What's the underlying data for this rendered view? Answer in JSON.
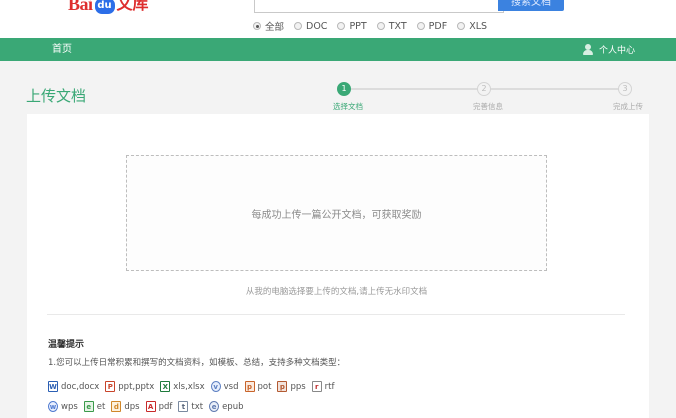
{
  "header": {
    "logo": {
      "bai": "Bai",
      "paw": "du",
      "wenku": "文库"
    },
    "search": {
      "button_label": "搜索文档",
      "placeholder": ""
    },
    "filters": [
      {
        "label": "全部",
        "checked": true
      },
      {
        "label": "DOC",
        "checked": false
      },
      {
        "label": "PPT",
        "checked": false
      },
      {
        "label": "TXT",
        "checked": false
      },
      {
        "label": "PDF",
        "checked": false
      },
      {
        "label": "XLS",
        "checked": false
      }
    ]
  },
  "nav": {
    "home": "首页",
    "user_center": "个人中心",
    "user_icon": "user-icon"
  },
  "page": {
    "title": "上传文档",
    "steps": [
      {
        "number": "1",
        "label": "选择文档",
        "active": true
      },
      {
        "number": "2",
        "label": "完善信息",
        "active": false
      },
      {
        "number": "3",
        "label": "完成上传",
        "active": false
      }
    ]
  },
  "upload": {
    "dropzone_text": "每成功上传一篇公开文档，可获取奖励",
    "hint": "从我的电脑选择要上传的文档,请上传无水印文档"
  },
  "tips": {
    "title": "温馨提示",
    "line1": "1.您可以上传日常积累和撰写的文档资料，如模板、总结，支持多种文档类型：",
    "types_row1": [
      {
        "icon": "W",
        "label": "doc,docx"
      },
      {
        "icon": "P",
        "label": "ppt,pptx"
      },
      {
        "icon": "X",
        "label": "xls,xlsx"
      },
      {
        "icon": "v",
        "label": "vsd"
      },
      {
        "icon": "p",
        "label": "pot"
      },
      {
        "icon": "p",
        "label": "pps"
      },
      {
        "icon": "r",
        "label": "rtf"
      }
    ],
    "types_row2": [
      {
        "icon": "w",
        "label": "wps"
      },
      {
        "icon": "e",
        "label": "et"
      },
      {
        "icon": "d",
        "label": "dps"
      },
      {
        "icon": "A",
        "label": "pdf"
      },
      {
        "icon": "t",
        "label": "txt"
      },
      {
        "icon": "e",
        "label": "epub"
      }
    ]
  },
  "colors": {
    "brand_green": "#3aa876",
    "logo_red": "#de2e2e",
    "logo_blue": "#2c6ee8",
    "search_blue": "#3b82e0"
  }
}
